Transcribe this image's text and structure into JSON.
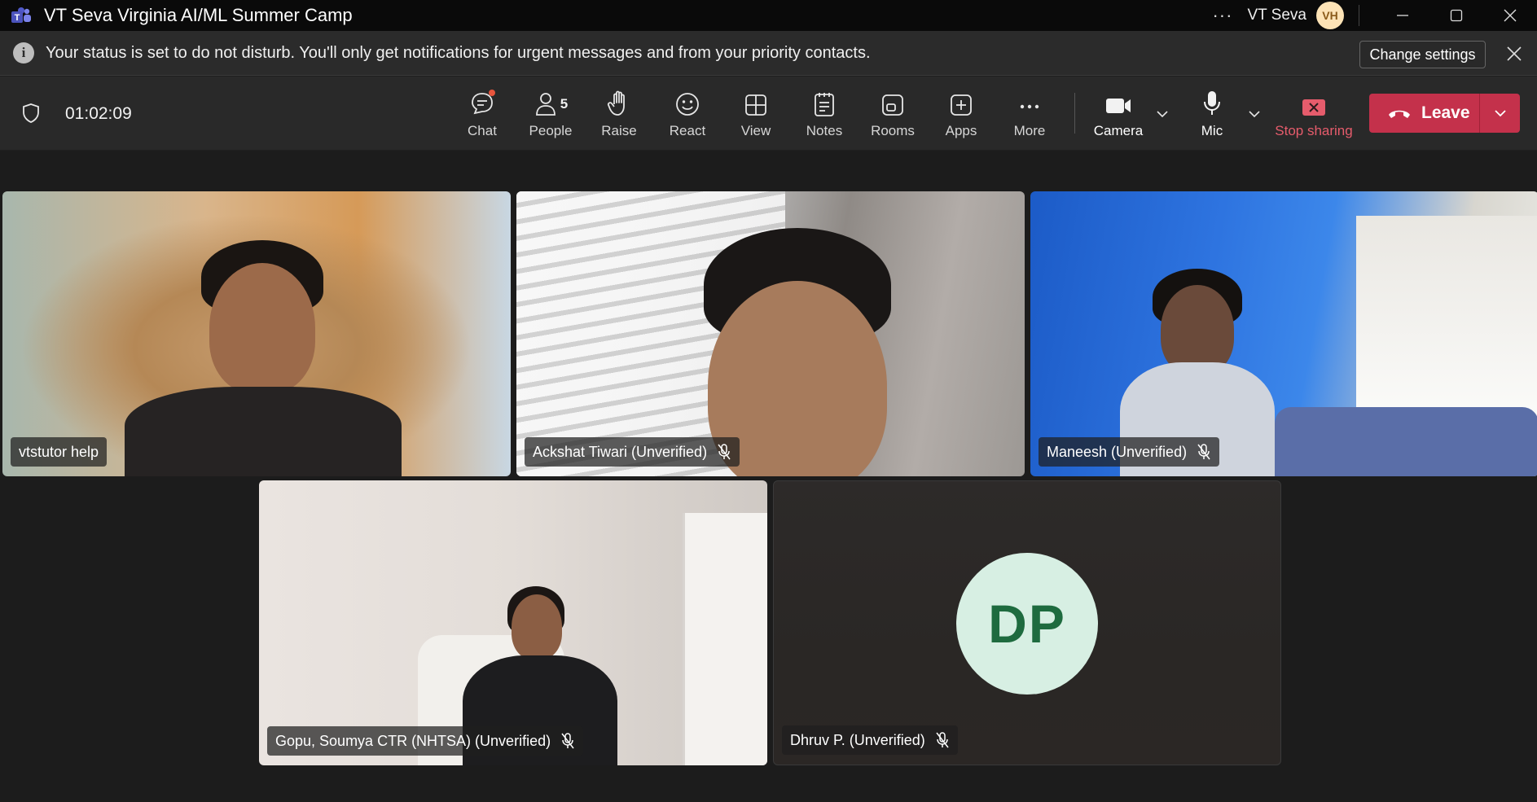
{
  "window": {
    "title": "VT Seva Virginia AI/ML Summer Camp",
    "account_name": "VT Seva",
    "account_initials": "VH",
    "more_label": "···"
  },
  "notification": {
    "info_glyph": "i",
    "message": "Your status is set to do not disturb. You'll only get notifications for urgent messages and from your priority contacts.",
    "action_label": "Change settings"
  },
  "toolbar": {
    "timer": "01:02:09",
    "chat_label": "Chat",
    "people_label": "People",
    "people_count": "5",
    "raise_label": "Raise",
    "react_label": "React",
    "view_label": "View",
    "notes_label": "Notes",
    "rooms_label": "Rooms",
    "apps_label": "Apps",
    "more_label": "More",
    "camera_label": "Camera",
    "mic_label": "Mic",
    "stop_sharing_label": "Stop sharing",
    "leave_label": "Leave",
    "colors": {
      "leave": "#c4314b",
      "stop_sharing": "#e65c6c",
      "chat_badge": "#e8553d"
    }
  },
  "participants": [
    {
      "name": "vtstutor help",
      "muted": false
    },
    {
      "name": "Ackshat Tiwari (Unverified)",
      "muted": true
    },
    {
      "name": "Maneesh (Unverified)",
      "muted": true
    },
    {
      "name": "Gopu, Soumya CTR (NHTSA) (Unverified)",
      "muted": true
    },
    {
      "name": "Dhruv P. (Unverified)",
      "muted": true,
      "initials": "DP",
      "avatar_color": "#d7efe3"
    }
  ]
}
